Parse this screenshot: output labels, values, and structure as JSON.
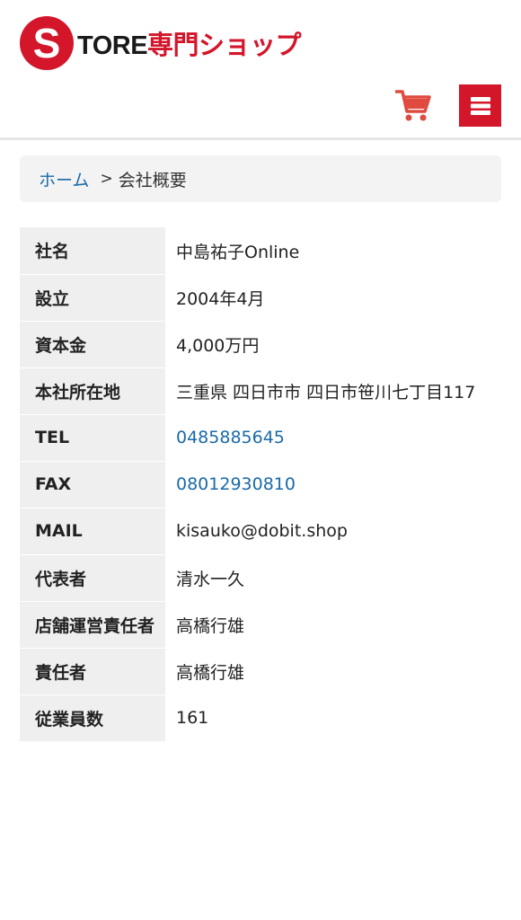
{
  "header": {
    "logo_letter": "S",
    "logo_text_main": "TORE",
    "logo_text_accent": "専門ショップ",
    "brand_color": "#d3162a",
    "cart_icon": "cart-icon",
    "menu_icon": "hamburger-menu-icon"
  },
  "breadcrumb": {
    "home": "ホーム",
    "separator": ">",
    "current": "会社概要"
  },
  "company": {
    "rows": [
      {
        "label": "社名",
        "value": "中島祐子Online"
      },
      {
        "label": "設立",
        "value": " 2004年4月"
      },
      {
        "label": "資本金",
        "value": " 4,000万円"
      },
      {
        "label": "本社所在地",
        "value": " 三重県 四日市市 四日市笹川七丁目117"
      },
      {
        "label": "TEL",
        "value": "0485885645"
      },
      {
        "label": "FAX",
        "value": "08012930810"
      },
      {
        "label": "MAIL",
        "value": "kisauko@dobit.shop"
      },
      {
        "label": "代表者",
        "value": "清水一久"
      },
      {
        "label": "店舗運営責任者",
        "value": "高橋行雄"
      },
      {
        "label": "責任者",
        "value": "高橋行雄"
      },
      {
        "label": "従業員数",
        "value": "161"
      }
    ],
    "link_color": "#1a6aa8"
  }
}
